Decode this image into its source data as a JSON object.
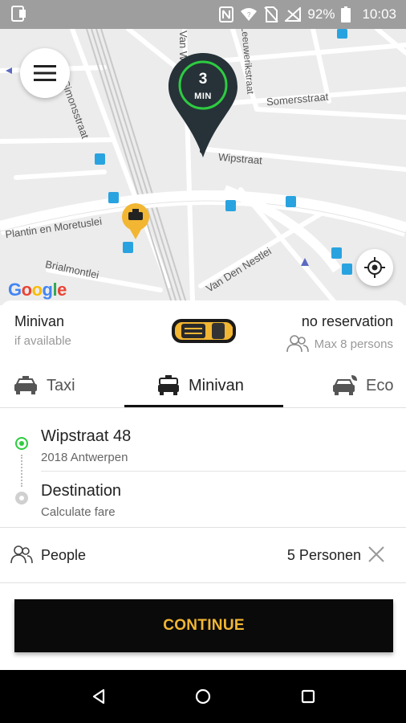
{
  "status_bar": {
    "battery": "92%",
    "time": "10:03"
  },
  "map": {
    "eta_value": "3",
    "eta_unit": "MIN",
    "google_logo": "Google",
    "streets": {
      "simonsstraat": "Simonsstraat",
      "van_w": "Van W",
      "leeuwerikstraat": "Leeuwerikstraat",
      "somersstraat": "Somersstraat",
      "wipstraat": "Wipstraat",
      "plantin": "Plantin en Moretuslei",
      "brialmontlei": "Brialmontlei",
      "van_den_nestlei": "Van Den Nestlei"
    }
  },
  "car": {
    "name": "Minivan",
    "availability": "if available",
    "reservation": "no reservation",
    "capacity": "Max 8 persons"
  },
  "tabs": [
    {
      "label": "Taxi",
      "active": false
    },
    {
      "label": "Minivan",
      "active": true
    },
    {
      "label": "Eco",
      "active": false
    }
  ],
  "route": {
    "pickup_title": "Wipstraat 48",
    "pickup_sub": "2018 Antwerpen",
    "destination_title": "Destination",
    "destination_sub": "Calculate fare"
  },
  "people": {
    "label": "People",
    "value": "5 Personen"
  },
  "continue_label": "CONTINUE",
  "colors": {
    "accent": "#f2b632",
    "pickup_dot": "#2ecc40",
    "button_bg": "#0a0a0a"
  }
}
